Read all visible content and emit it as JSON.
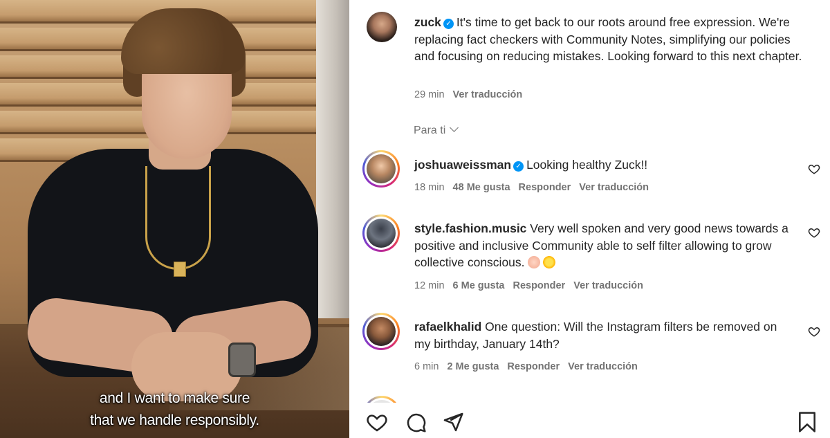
{
  "video": {
    "caption_line1": "and I want to make sure",
    "caption_line2": "that we handle responsibly."
  },
  "post": {
    "username": "zuck",
    "verified": true,
    "text": "It's time to get back to our roots around free expression. We're replacing fact checkers with Community Notes, simplifying our policies and focusing on reducing mistakes. Looking forward to this next chapter.",
    "time": "29 min",
    "translate": "Ver traducción"
  },
  "filter": {
    "label": "Para ti"
  },
  "comments": [
    {
      "username": "joshuaweissman",
      "verified": true,
      "text": "Looking healthy Zuck!!",
      "time": "18 min",
      "likes": "48 Me gusta",
      "reply": "Responder",
      "translate": "Ver traducción"
    },
    {
      "username": "style.fashion.music",
      "verified": false,
      "text": "Very well spoken and very good news towards a positive and inclusive Community able to self filter allowing to grow collective conscious.",
      "emojis": [
        "clapping-hands-emoji",
        "sun-emoji"
      ],
      "time": "12 min",
      "likes": "6 Me gusta",
      "reply": "Responder",
      "translate": "Ver traducción"
    },
    {
      "username": "rafaelkhalid",
      "verified": false,
      "text": "One question: Will the Instagram filters be removed on my birthday, January 14th?",
      "time": "6 min",
      "likes": "2 Me gusta",
      "reply": "Responder",
      "translate": "Ver traducción"
    }
  ],
  "actions": [
    "heart-icon",
    "comment-icon",
    "share-icon",
    "bookmark-icon"
  ],
  "colors": {
    "text": "#262626",
    "secondary": "#737373",
    "verified_blue": "#0095f6"
  }
}
